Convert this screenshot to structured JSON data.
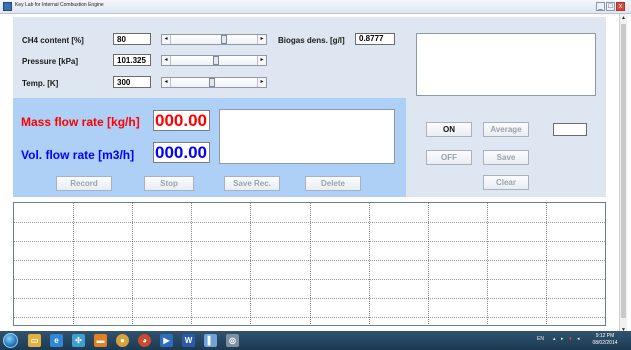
{
  "window": {
    "title": "Key Lab for Internal Combustion Engine",
    "minimize_label": "_",
    "restore_label": "□",
    "close_label": "x"
  },
  "inputs": {
    "ch4": {
      "label": "CH4 content [%]",
      "value": "80",
      "slider_level": 0.62
    },
    "pressure": {
      "label": "Pressure [kPa]",
      "value": "101.325",
      "slider_level": 0.52
    },
    "temp": {
      "label": "Temp. [K]",
      "value": "300",
      "slider_level": 0.48
    },
    "biogas_density": {
      "label": "Biogas dens. [g/l]",
      "value": "0.8777"
    }
  },
  "readouts": {
    "mass_flow": {
      "label": "Mass flow rate [kg/h]",
      "value": "000.00",
      "color": "#ff0000"
    },
    "vol_flow": {
      "label": "Vol. flow rate [m3/h]",
      "value": "000.00",
      "color": "#0000ff"
    }
  },
  "buttons": {
    "record": "Record",
    "stop": "Stop",
    "save_rec": "Save Rec.",
    "delete": "Delete",
    "on": "ON",
    "off": "OFF",
    "average": "Average",
    "save": "Save",
    "clear": "Clear"
  },
  "grid": {
    "rows": 6,
    "cols": 10
  },
  "taskbar": {
    "apps": [
      "explorer",
      "ie",
      "network",
      "presentation",
      "chrome",
      "paint",
      "media",
      "word",
      "chart",
      "settings"
    ],
    "tray_lang": "EN",
    "time": "9:12 PM",
    "date": "08/02/2014"
  },
  "colors": {
    "panel_top": "#dde6f1",
    "panel_mid": "#aed0f6",
    "mass_flow_color": "#ff0000",
    "vol_flow_color": "#0000ff"
  }
}
